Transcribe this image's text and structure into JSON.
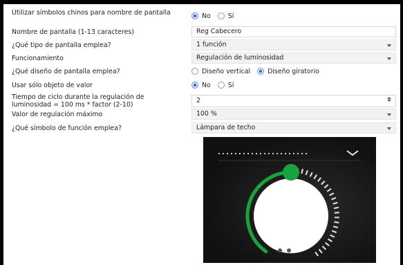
{
  "rows": {
    "chinese_symbols": {
      "label": "Utilizar símbolos chinos para nombre de pantalla",
      "options": [
        "No",
        "Sí"
      ],
      "selected": "No"
    },
    "screen_name": {
      "label": "Nombre de pantalla (1-13 caracteres)",
      "value": "Reg Cabecero"
    },
    "screen_type": {
      "label": "¿Qué tipo de pantalla emplea?",
      "value": "1 función"
    },
    "operation": {
      "label": "Funcionamiento",
      "value": "Regulación de luminosidad"
    },
    "screen_design": {
      "label": "¿Qué diseño de pantalla emplea?",
      "options": [
        "Diseño vertical",
        "Diseño giratorio"
      ],
      "selected": "Diseño giratorio"
    },
    "value_object_only": {
      "label": "Usar sólo objeto de valor",
      "options": [
        "No",
        "Sí"
      ],
      "selected": "No"
    },
    "cycle_time": {
      "label_line1": "Tiempo de ciclo durante la regulación de",
      "label_line2": "luminosidad = 100 ms * factor (2-10)",
      "value": "2"
    },
    "max_dimming": {
      "label": "Valor de regulación máximo",
      "value": "100 %"
    },
    "function_symbol": {
      "label": "¿Qué símbolo de función emplea?",
      "value": "Lámpara de techo"
    }
  },
  "preview": {
    "icon": "chevron-down-icon",
    "dimmer_level": 0.65,
    "page_dots": 3,
    "active_dot": 3,
    "accent_color": "#1aa33c"
  }
}
